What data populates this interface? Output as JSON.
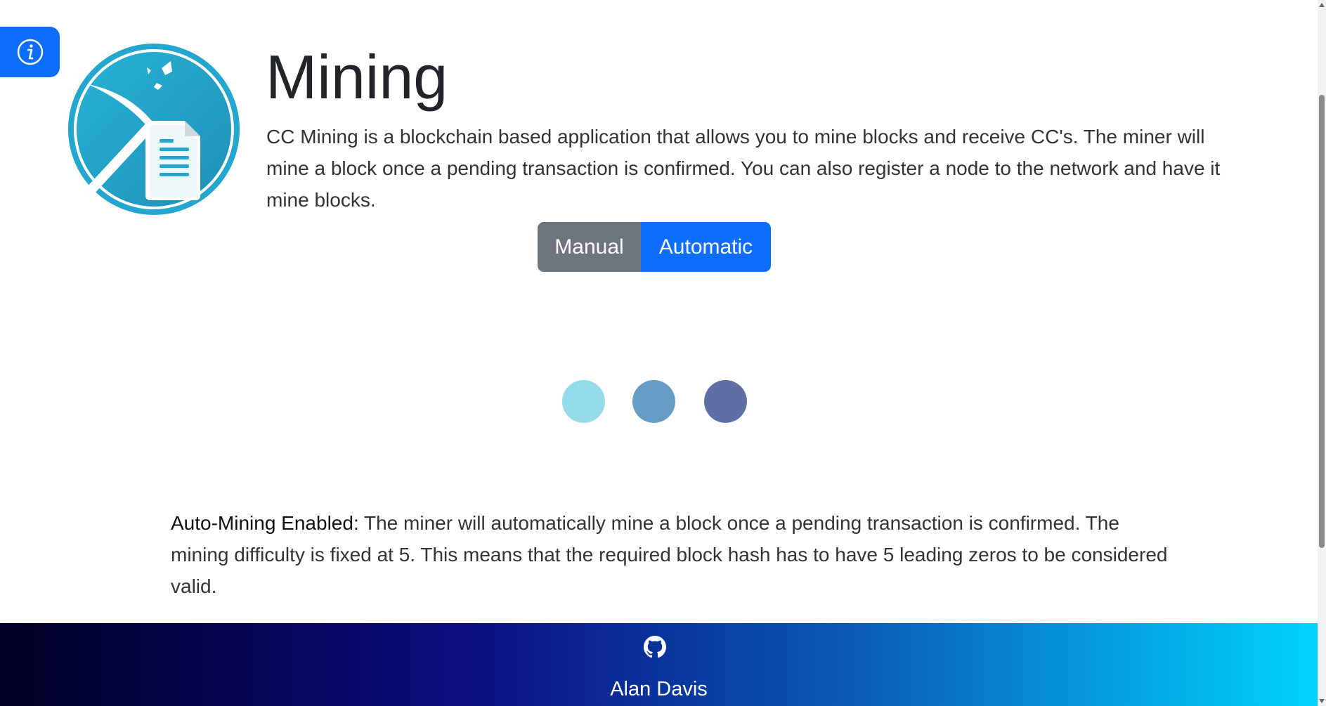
{
  "info_tab": {
    "icon": "info-circle-icon"
  },
  "logo": {
    "icon": "mining-pickaxe-document-icon"
  },
  "page": {
    "title": "Mining",
    "description": "CC Mining is a blockchain based application that allows you to mine blocks and receive CC's. The miner will mine a block once a pending transaction is confirmed. You can also register a node to the network and have it mine blocks."
  },
  "mode_toggle": {
    "manual_label": "Manual",
    "automatic_label": "Automatic",
    "selected": "Automatic"
  },
  "loader": {
    "colors": [
      "#94dbe9",
      "#679dc5",
      "#5f6ea4"
    ]
  },
  "status": {
    "label": "Auto-Mining Enabled:",
    "text": " The miner will automatically mine a block once a pending transaction is confirmed. The mining difficulty is fixed at 5. This means that the required block hash has to have 5 leading zeros to be considered valid."
  },
  "footer": {
    "icon": "github-icon",
    "author": "Alan Davis"
  },
  "colors": {
    "primary": "#0d6efd",
    "secondary": "#6c757d",
    "logo_teal": "#24a7cf"
  }
}
